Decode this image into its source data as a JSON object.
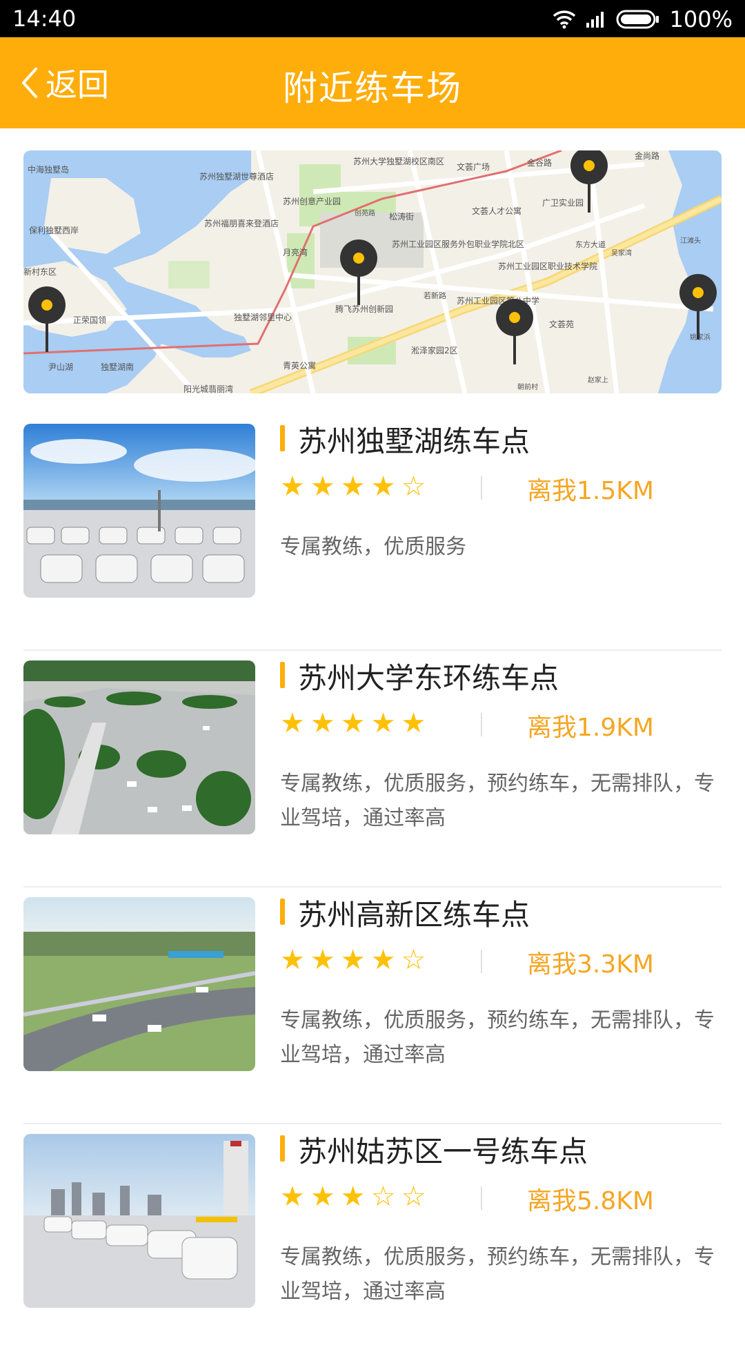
{
  "status_bar": {
    "time": "14:40",
    "battery": "100%"
  },
  "header": {
    "back_label": "返回",
    "title": "附近练车场"
  },
  "map": {
    "labels": [
      "中海独墅岛",
      "苏州独墅湖世尊酒店",
      "苏州福朋喜来登酒店",
      "保利独墅西岸",
      "新村东区",
      "正荣国领",
      "尹山湖",
      "独墅湖南",
      "独墅湖邻里中心",
      "月亮湾",
      "苏州创意产业园",
      "苏州大学独墅湖校区南区",
      "文荟广场",
      "金谷路",
      "金尚路",
      "广卫实业园",
      "文荟人才公寓",
      "松涛街",
      "苏州工业园区服务外包职业学院北区",
      "苏州工业园区职业技术学院",
      "腾飞苏州创新园",
      "苏州工业园区第八中学",
      "淞泽家园2区",
      "青英公寓",
      "文荟苑",
      "阳光城翡丽湾",
      "东方大道",
      "创苑路",
      "若新路",
      "吴家湾",
      "江滩头",
      "姚家浜",
      "朝前村",
      "赵家上"
    ]
  },
  "venues": [
    {
      "name": "苏州独墅湖练车点",
      "rating": 4,
      "distance": "离我1.5KM",
      "desc": "专属教练，优质服务"
    },
    {
      "name": "苏州大学东环练车点",
      "rating": 5,
      "distance": "离我1.9KM",
      "desc": "专属教练，优质服务，预约练车，无需排队，专业驾培，通过率高"
    },
    {
      "name": "苏州高新区练车点",
      "rating": 4,
      "distance": "离我3.3KM",
      "desc": "专属教练，优质服务，预约练车，无需排队，专业驾培，通过率高"
    },
    {
      "name": "苏州姑苏区一号练车点",
      "rating": 3,
      "distance": "离我5.8KM",
      "desc": "专属教练，优质服务，预约练车，无需排队，专业驾培，通过率高"
    }
  ],
  "colors": {
    "accent": "#FFAD0A",
    "star": "#FFC107",
    "distance": "#F5A623"
  }
}
